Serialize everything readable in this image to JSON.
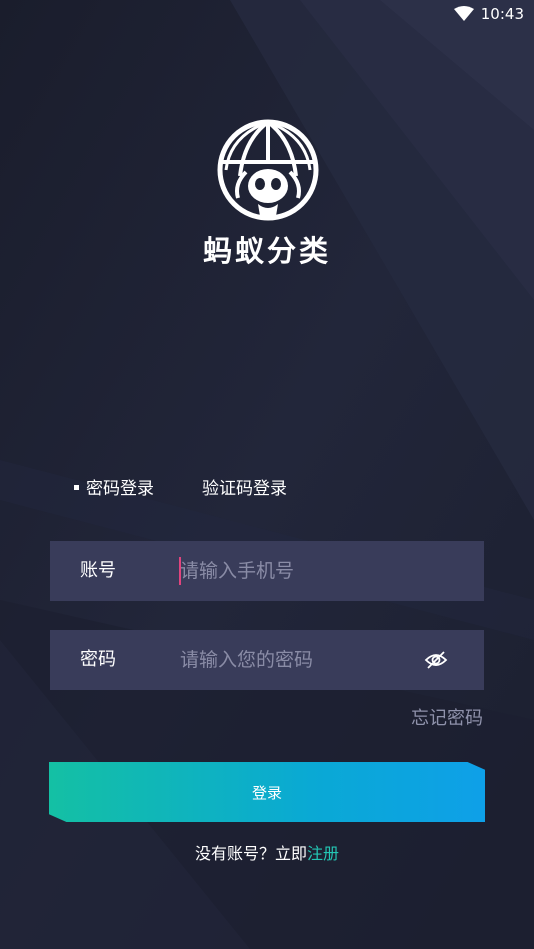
{
  "status_bar": {
    "time": "10:43",
    "wifi_icon": "wifi-icon"
  },
  "app": {
    "name": "蚂蚁分类",
    "logo_icon": "ant-globe-logo"
  },
  "tabs": [
    {
      "label": "密码登录",
      "active": true
    },
    {
      "label": "验证码登录",
      "active": false
    }
  ],
  "form": {
    "account": {
      "label": "账号",
      "placeholder": "请输入手机号",
      "value": ""
    },
    "password": {
      "label": "密码",
      "placeholder": "请输入您的密码",
      "value": "",
      "toggle_icon": "eye-hidden-icon"
    },
    "forgot_label": "忘记密码"
  },
  "login_button": {
    "label": "登录"
  },
  "register": {
    "prompt": "没有账号？立即",
    "link_label": "注册"
  },
  "colors": {
    "background": "#1e2233",
    "field_background": "#393c5a",
    "accent_teal": "#24c6b4",
    "button_gradient_start": "#14c0a4",
    "button_gradient_end": "#0ea0e8",
    "caret": "#e0447e"
  }
}
